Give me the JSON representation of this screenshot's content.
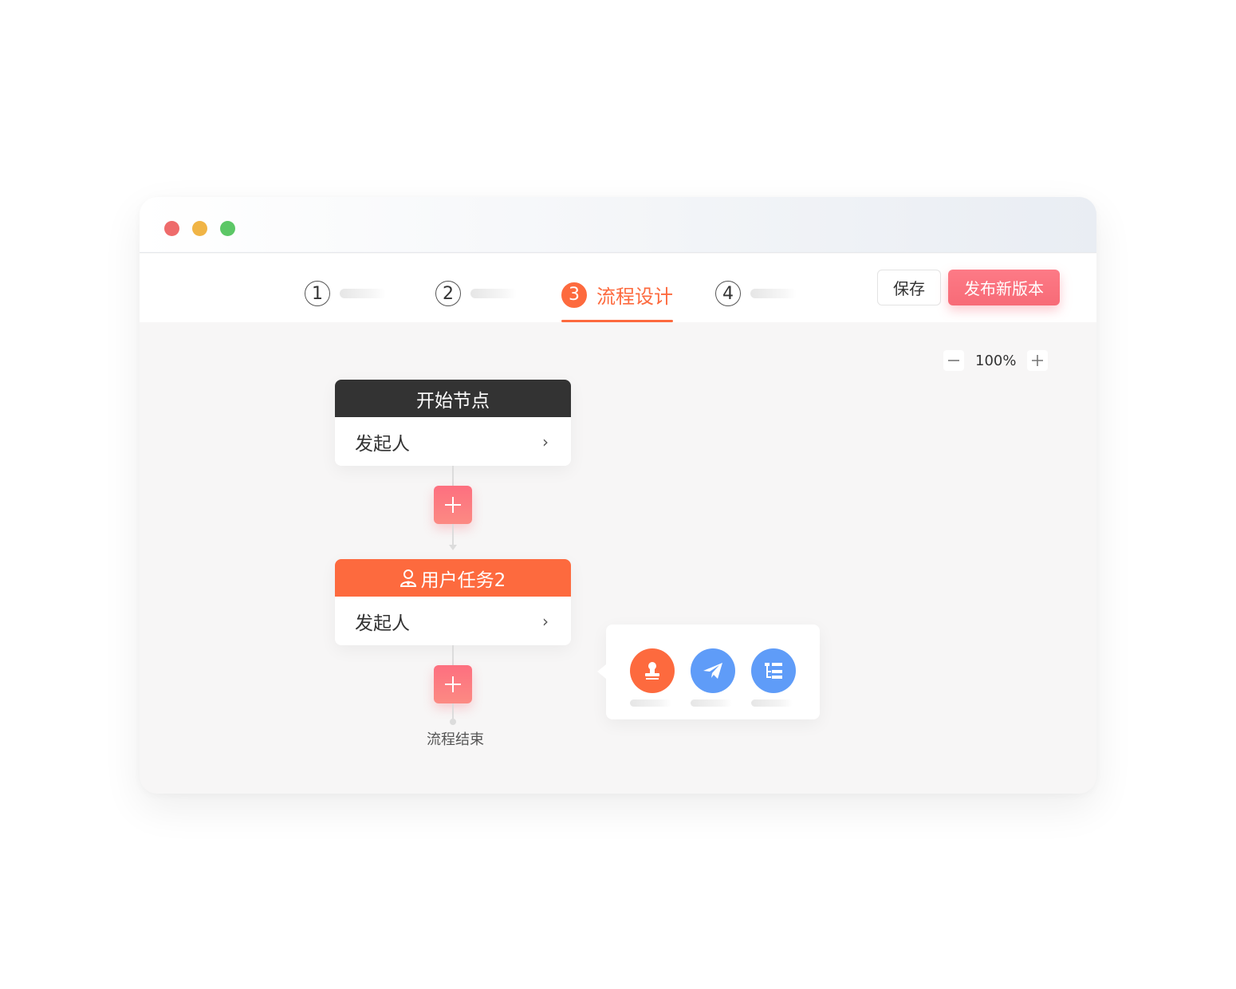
{
  "window": {
    "traffic_lights": [
      "close",
      "minimize",
      "maximize"
    ]
  },
  "steps": [
    {
      "number": "1",
      "label": ""
    },
    {
      "number": "2",
      "label": ""
    },
    {
      "number": "3",
      "label": "流程设计",
      "active": true
    },
    {
      "number": "4",
      "label": ""
    }
  ],
  "toolbar": {
    "save_label": "保存",
    "publish_label": "发布新版本"
  },
  "zoom": {
    "minus": "−",
    "value": "100%",
    "plus": "+"
  },
  "flow": {
    "start_node": {
      "title": "开始节点",
      "body": "发起人",
      "chevron": "›"
    },
    "task_node": {
      "title": "用户任务2",
      "body": "发起人",
      "chevron": "›",
      "icon": "user-icon"
    },
    "end_label": "流程结束"
  },
  "popover": {
    "items": [
      {
        "icon": "stamp-icon",
        "color": "#fd6a3e"
      },
      {
        "icon": "send-icon",
        "color": "#5f9cf8"
      },
      {
        "icon": "branch-list-icon",
        "color": "#5f9cf8"
      }
    ]
  },
  "colors": {
    "accent": "#fd6a3e",
    "publish": "#f76b77",
    "dark_header": "#333333",
    "blue": "#5f9cf8"
  }
}
